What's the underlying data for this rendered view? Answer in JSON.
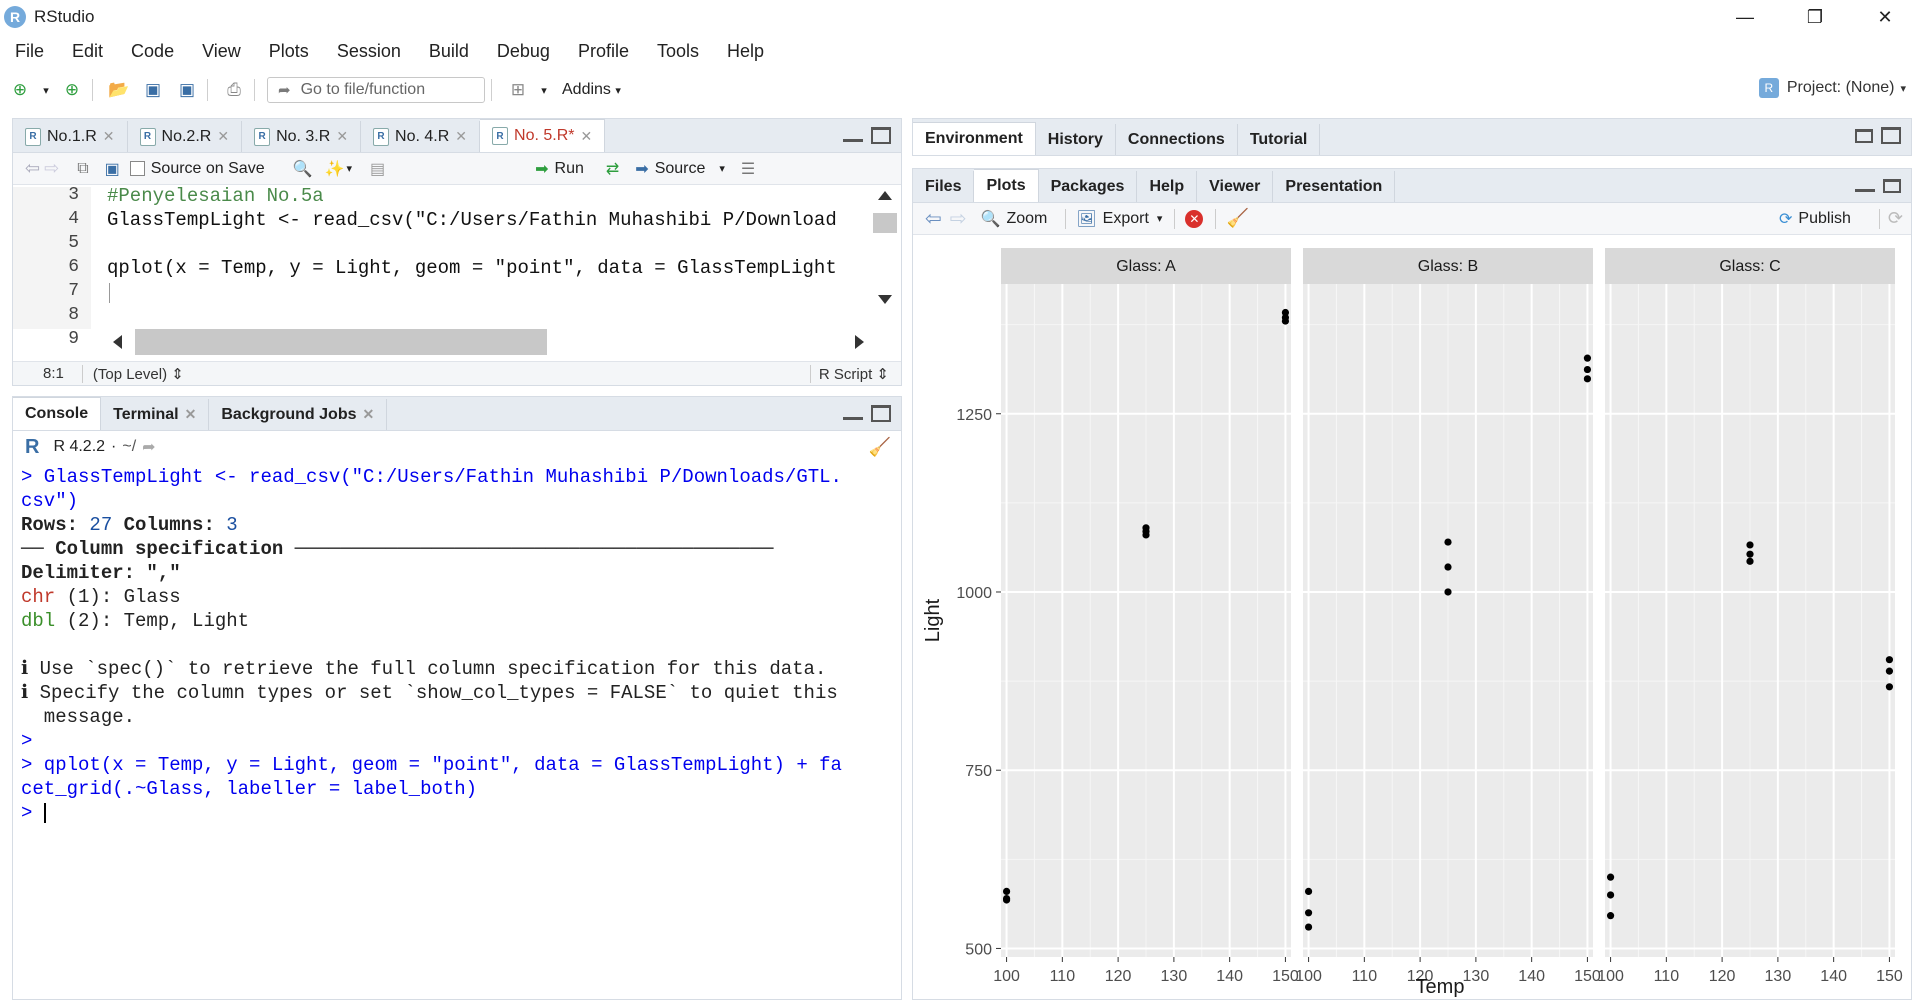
{
  "window": {
    "app_title": "RStudio",
    "logo_letter": "R"
  },
  "menu": [
    "File",
    "Edit",
    "Code",
    "View",
    "Plots",
    "Session",
    "Build",
    "Debug",
    "Profile",
    "Tools",
    "Help"
  ],
  "toolbar": {
    "goto_placeholder": "Go to file/function",
    "addins_label": "Addins",
    "project_label": "Project: (None)"
  },
  "editor": {
    "tabs": [
      {
        "label": "No.1.R",
        "active": false,
        "unsaved": false
      },
      {
        "label": "No.2.R",
        "active": false,
        "unsaved": false
      },
      {
        "label": "No. 3.R",
        "active": false,
        "unsaved": false
      },
      {
        "label": "No. 4.R",
        "active": false,
        "unsaved": false
      },
      {
        "label": "No. 5.R*",
        "active": true,
        "unsaved": true
      }
    ],
    "source_on_save": "Source on Save",
    "run_label": "Run",
    "source_label": "Source",
    "lines": [
      {
        "num": "3",
        "text": "#Penyelesaian No.5a",
        "comment": true
      },
      {
        "num": "4",
        "text": "GlassTempLight <- read_csv(\"C:/Users/Fathin Muhashibi P/Download",
        "comment": false
      },
      {
        "num": "5",
        "text": "",
        "comment": false
      },
      {
        "num": "6",
        "text": "qplot(x = Temp, y = Light, geom = \"point\", data = GlassTempLight",
        "comment": false
      },
      {
        "num": "7",
        "text": "",
        "comment": false
      },
      {
        "num": "8",
        "text": "",
        "comment": false
      },
      {
        "num": "9",
        "text": "",
        "comment": false
      }
    ],
    "status_position": "8:1",
    "status_scope": "(Top Level)",
    "status_type": "R Script"
  },
  "console": {
    "tabs": [
      "Console",
      "Terminal",
      "Background Jobs"
    ],
    "r_version": "R 4.2.2",
    "working_dir": "~/",
    "lines": {
      "cmd1a": "> GlassTempLight <- read_csv(\"C:/Users/Fathin Muhashibi P/Downloads/GTL.",
      "cmd1b": "csv\")",
      "rows_label": "Rows:",
      "rows_value": "27",
      "cols_label": "Columns:",
      "cols_value": "3",
      "spec_header": "── Column specification ──────────────────────────────────────────",
      "delimiter": "Delimiter: \",\"",
      "chr_type": "chr",
      "chr_rest": " (1): Glass",
      "dbl_type": "dbl",
      "dbl_rest": " (2): Temp, Light",
      "info1": "ℹ Use `spec()` to retrieve the full column specification for this data.",
      "info2": "ℹ Specify the column types or set `show_col_types = FALSE` to quiet this",
      "info3": "  message.",
      "prompt_empty": ">",
      "cmd2a": "> qplot(x = Temp, y = Light, geom = \"point\", data = GlassTempLight) + fa",
      "cmd2b": "cet_grid(.~Glass, labeller = label_both)",
      "prompt_cursor": "> "
    }
  },
  "env_pane": {
    "tabs": [
      "Environment",
      "History",
      "Connections",
      "Tutorial"
    ]
  },
  "files_pane": {
    "tabs": [
      "Files",
      "Plots",
      "Packages",
      "Help",
      "Viewer",
      "Presentation"
    ],
    "active_tab": "Plots",
    "zoom_label": "Zoom",
    "export_label": "Export",
    "publish_label": "Publish"
  },
  "chart_data": {
    "type": "scatter",
    "facets": [
      "Glass: A",
      "Glass: B",
      "Glass: C"
    ],
    "xlabel": "Temp",
    "ylabel": "Light",
    "xlim": [
      99,
      151
    ],
    "ylim": [
      488,
      1432
    ],
    "xticks": [
      100,
      110,
      120,
      130,
      140,
      150
    ],
    "yticks": [
      500,
      750,
      1000,
      1250
    ],
    "grid": true,
    "panels": [
      {
        "facet": "Glass: A",
        "x": [
          100,
          100,
          100,
          125,
          125,
          125,
          150,
          150,
          150
        ],
        "y": [
          580,
          568,
          570,
          1090,
          1085,
          1080,
          1392,
          1380,
          1385
        ]
      },
      {
        "facet": "Glass: B",
        "x": [
          100,
          100,
          100,
          125,
          125,
          125,
          150,
          150,
          150
        ],
        "y": [
          580,
          550,
          530,
          1070,
          1035,
          1000,
          1328,
          1312,
          1299
        ]
      },
      {
        "facet": "Glass: C",
        "x": [
          100,
          100,
          100,
          125,
          125,
          125,
          150,
          150,
          150
        ],
        "y": [
          600,
          575,
          546,
          1066,
          1053,
          1043,
          905,
          889,
          867
        ]
      }
    ]
  },
  "colors": {
    "panel_bg": "#ebebeb",
    "strip_bg": "#d9d9d9",
    "point": "#000000",
    "tab_bg": "#e6ebf1"
  }
}
